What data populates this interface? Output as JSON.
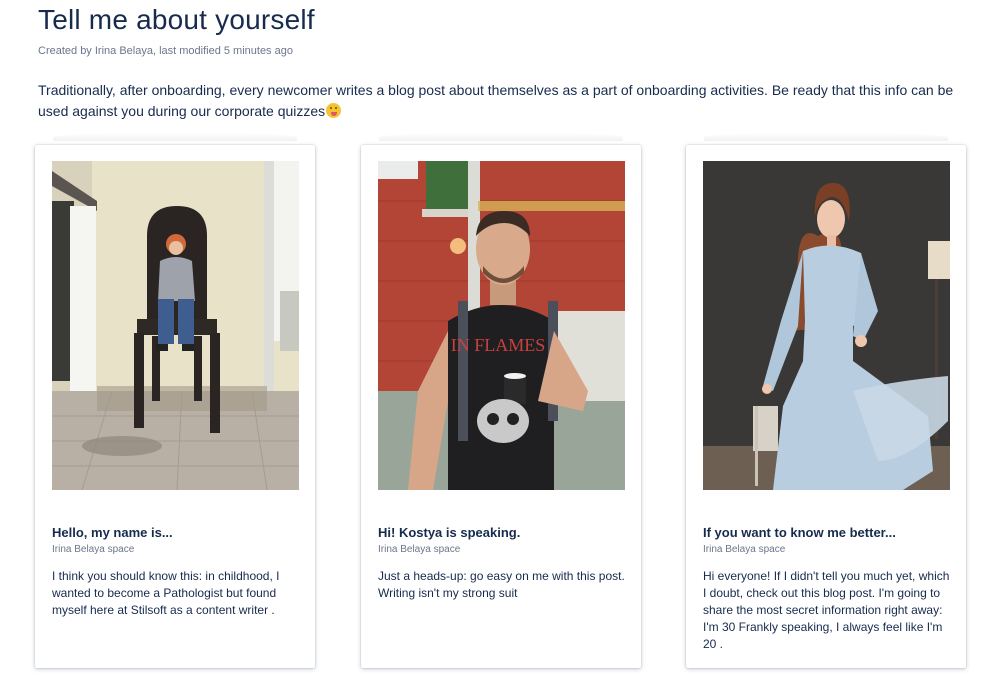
{
  "page": {
    "title": "Tell me about yourself",
    "byline": "Created by Irina Belaya, last modified 5 minutes ago",
    "intro": "Traditionally, after onboarding, every newcomer writes a blog post about themselves as a part of onboarding activities. Be ready that this info can be used against you during our corporate quizzes",
    "intro_emoji": "face-with-tongue-emoji"
  },
  "cards": [
    {
      "title": "Hello, my name is...",
      "space": "Irina Belaya space",
      "body": "I think you should know this: in childhood, I wanted to become a Pathologist but found myself here at Stilsoft as a content writer .",
      "photo": "woman-on-giant-chair-photo"
    },
    {
      "title": "Hi! Kostya is speaking.",
      "space": "Irina Belaya space",
      "body": "Just a heads-up: go easy on me with this post. Writing isn't my strong suit",
      "photo": "man-with-coffee-cup-photo"
    },
    {
      "title": "If you want to know me better...",
      "space": "Irina Belaya space",
      "body": "Hi everyone! If I didn't tell you much yet, which I doubt, check out this blog post. I'm going to share the most secret information right away: I'm 30 Frankly speaking, I always feel like I'm 20 .",
      "photo": "woman-in-blue-dress-photo"
    }
  ],
  "colors": {
    "heading": "#172b4d",
    "meta": "#6b778c",
    "card_bg": "#ffffff"
  }
}
